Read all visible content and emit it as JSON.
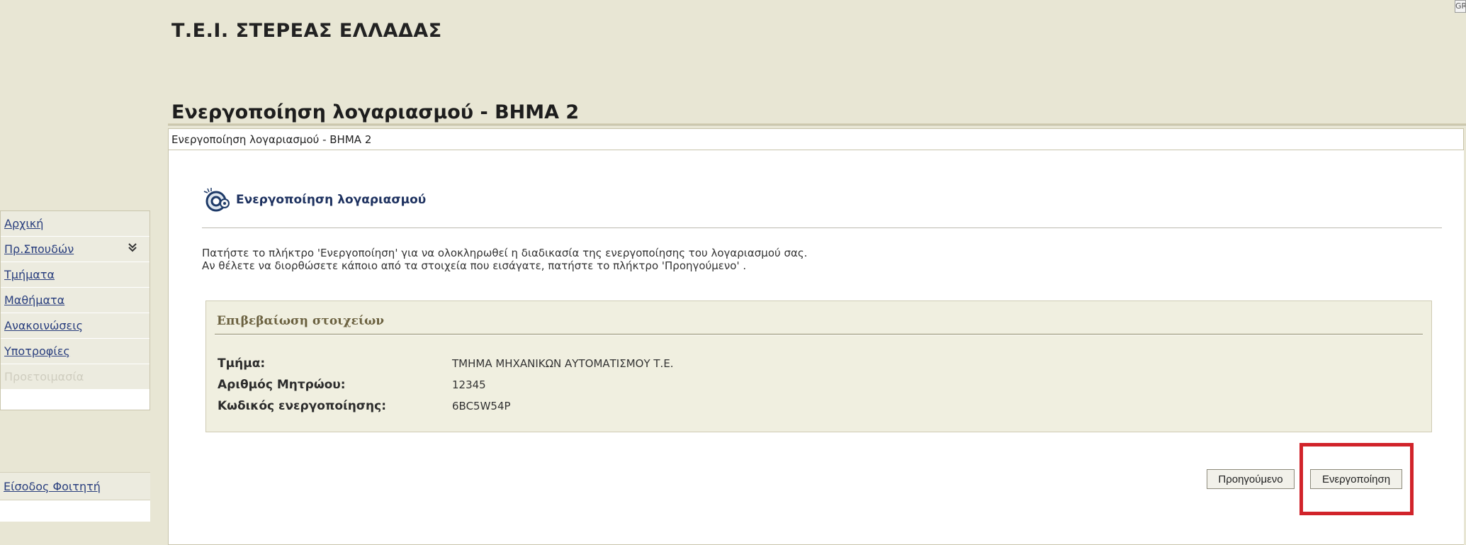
{
  "header": {
    "institution": "Τ.Ε.Ι. ΣΤΕΡΕΑΣ ΕΛΛΑΔΑΣ",
    "page_title": "Ενεργοποίηση λογαριασμού - ΒΗΜΑ 2",
    "lang_badge": "GR"
  },
  "breadcrumb": "Ενεργοποίηση λογαριασμού - ΒΗΜΑ 2",
  "sidebar": {
    "items": [
      {
        "label": "Αρχική"
      },
      {
        "label": "Πρ.Σπουδών",
        "icon": "chevron-down-double-icon"
      },
      {
        "label": "Τμήματα"
      },
      {
        "label": "Μαθήματα"
      },
      {
        "label": "Ανακοινώσεις"
      },
      {
        "label": "Υποτροφίες"
      },
      {
        "label": "Προετοιμασία"
      }
    ],
    "student_login": "Είσοδος Φοιτητή"
  },
  "section": {
    "title": "Ενεργοποίηση λογαριασμού",
    "icon": "activation-icon",
    "instructions_line1": "Πατήστε το πλήκτρο 'Ενεργοποίηση' για να ολοκληρωθεί η διαδικασία της ενεργοποίησης του λογαριασμού σας.",
    "instructions_line2": "Αν θέλετε να διορθώσετε κάποιο από τα στοιχεία που εισάγατε, πατήστε το πλήκτρο 'Προηγούμενο' ."
  },
  "confirmation": {
    "title": "Επιβεβαίωση στοιχείων",
    "fields": [
      {
        "label": "Τμήμα:",
        "value": "ΤΜΗΜΑ ΜΗΧΑΝΙΚΩΝ ΑΥΤΟΜΑΤΙΣΜΟΥ Τ.Ε."
      },
      {
        "label": "Αριθμός Μητρώου:",
        "value": "12345"
      },
      {
        "label": "Κωδικός ενεργοποίησης:",
        "value": "6BC5W54P"
      }
    ]
  },
  "buttons": {
    "previous": "Προηγούμενο",
    "activate": "Ενεργοποίηση"
  },
  "colors": {
    "highlight": "#d1232a",
    "page_background": "#e8e6d4",
    "link": "#2a3f7e"
  }
}
